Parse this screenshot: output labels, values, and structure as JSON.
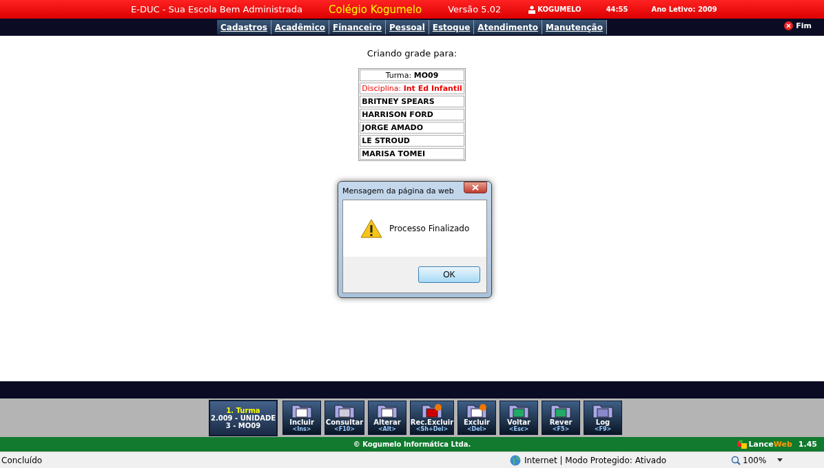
{
  "header": {
    "app_title": "E-DUC - Sua Escola Bem Administrada",
    "school": "Colégio Kogumelo",
    "version": "Versão 5.02",
    "user": "KOGUMELO",
    "timer": "44:55",
    "year": "Ano Letivo: 2009"
  },
  "menu": [
    "Cadastros",
    "Acadêmico",
    "Financeiro",
    "Pessoal",
    "Estoque",
    "Atendimento",
    "Manutenção"
  ],
  "exit_label": "Fim",
  "content": {
    "heading": "Criando grade para:",
    "turma_label": "Turma:",
    "turma": "MO09",
    "disciplina_label": "Disciplina:",
    "disciplina": "Int Ed Infantil",
    "students": [
      "BRITNEY SPEARS",
      "HARRISON FORD",
      "JORGE AMADO",
      "LE STROUD",
      "MARISA TOMEI"
    ]
  },
  "dialog": {
    "title": "Mensagem da página da web",
    "message": "Processo Finalizado",
    "button": "OK"
  },
  "context": {
    "title": "1. Turma",
    "lines": [
      "2.009 - UNIDADE",
      "3 - MO09"
    ]
  },
  "toolbar": [
    {
      "kind": "new",
      "label": "Incluir",
      "key": "<Ins>"
    },
    {
      "kind": "list",
      "label": "Consultar",
      "key": "<F10>"
    },
    {
      "kind": "edit",
      "label": "Alterar",
      "key": "<Alt>"
    },
    {
      "kind": "restore",
      "label": "Rec.Excluir",
      "key": "<Sh+Del>"
    },
    {
      "kind": "delete",
      "label": "Excluir",
      "key": "<Del>"
    },
    {
      "kind": "back",
      "label": "Voltar",
      "key": "<Esc>"
    },
    {
      "kind": "refresh",
      "label": "Rever",
      "key": "<F5>"
    },
    {
      "kind": "user",
      "label": "Log",
      "key": "<F9>"
    }
  ],
  "footer": {
    "copyright": "© Kogumelo Informática Ltda.",
    "brand_a": "Lance",
    "brand_b": "Web",
    "brand_version": "1.45"
  },
  "status_bar": {
    "status": "Concluído",
    "zone": "Internet | Modo Protegido: Ativado",
    "zoom": "100%"
  }
}
